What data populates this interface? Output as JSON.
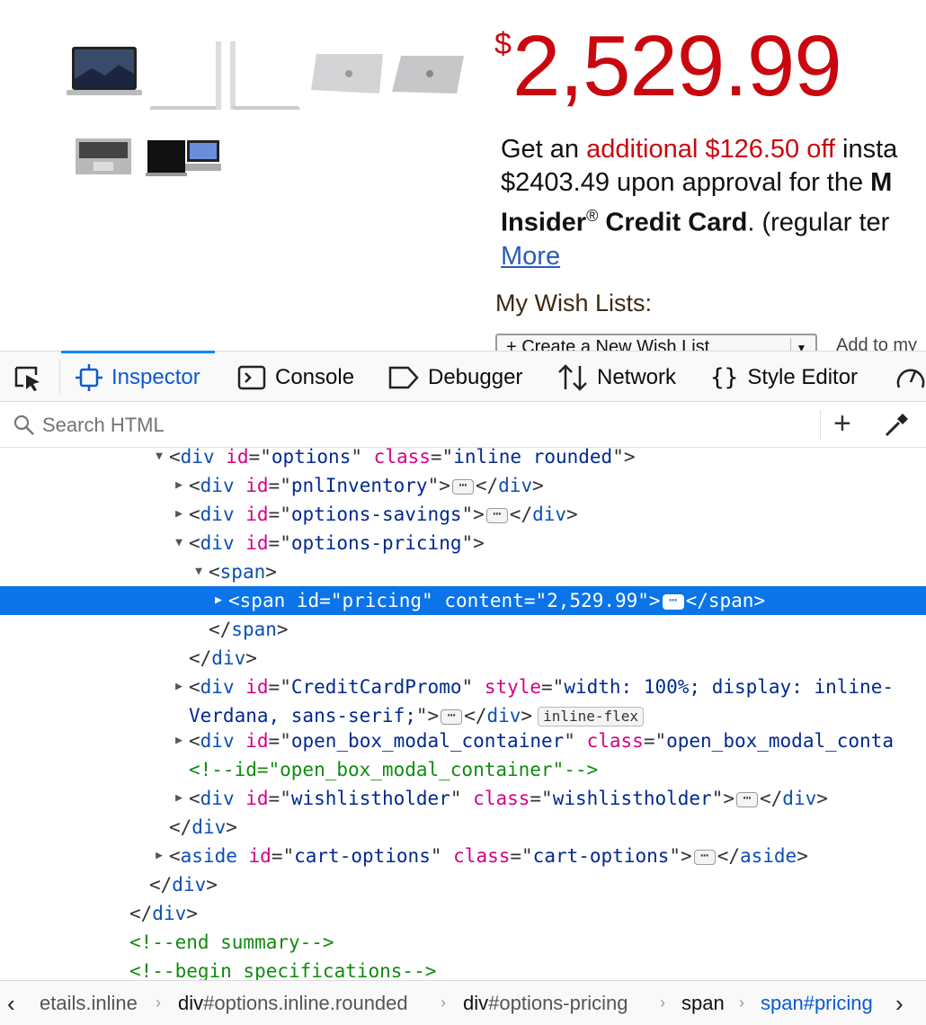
{
  "product": {
    "thumbnails": [
      "macbook-screen-front",
      "macbook-side-open",
      "macbook-lid-closed-angle",
      "macbook-lid-closed-front",
      "macbook-keyboard-top",
      "macbook-screen-black",
      "macbook-screen-colorful"
    ],
    "currency_symbol": "$",
    "price": "2,529.99",
    "promo": {
      "line1_pre": "Get an ",
      "line1_red": "additional $126.50 off",
      "line1_post": " insta",
      "line2_pre": "$2403.49 upon approval for the ",
      "line2_bold": "M",
      "line3_bold_a": "Insider",
      "line3_reg": "®",
      "line3_bold_b": " Credit Card",
      "line3_post": ". (regular ter",
      "more_link": "More"
    },
    "wishlist_label": "My Wish Lists:",
    "wishlist_select": "+ Create a New Wish List",
    "add_to_label": "Add to my"
  },
  "devtools": {
    "tabs": [
      {
        "label": "Inspector",
        "icon": "inspector-icon",
        "active": true
      },
      {
        "label": "Console",
        "icon": "console-icon"
      },
      {
        "label": "Debugger",
        "icon": "debugger-icon"
      },
      {
        "label": "Network",
        "icon": "network-icon"
      },
      {
        "label": "Style Editor",
        "icon": "style-editor-icon"
      }
    ],
    "search_placeholder": "Search HTML",
    "tree": {
      "l0": {
        "tag": "div",
        "attrs": [
          [
            "id",
            "options"
          ],
          [
            "class",
            "inline rounded"
          ]
        ]
      },
      "l1": {
        "tag": "div",
        "id_val": "pnlInventory"
      },
      "l2": {
        "tag": "div",
        "id_val": "options-savings"
      },
      "l3": {
        "tag": "div",
        "id_val": "options-pricing"
      },
      "l4": {
        "tag": "span"
      },
      "l5": {
        "tag": "span",
        "id_val": "pricing",
        "content_val": "2,529.99"
      },
      "l6": {
        "close": "span"
      },
      "l7": {
        "close": "div"
      },
      "l8": {
        "tag": "div",
        "id_val": "CreditCardPromo",
        "style_val_a": "width: 100%; display: inline-",
        "style_val_b": "Verdana, sans-serif;",
        "badge": "inline-flex"
      },
      "l10": {
        "tag": "div",
        "id_val": "open_box_modal_container",
        "class_val": "open_box_modal_conta"
      },
      "l11": {
        "comment": "<!--id=\"open_box_modal_container\"-->"
      },
      "l12": {
        "tag": "div",
        "id_val": "wishlistholder",
        "class_val": "wishlistholder"
      },
      "l13": {
        "close": "div"
      },
      "l14": {
        "tag": "aside",
        "id_val": "cart-options",
        "class_val": "cart-options"
      },
      "l15": {
        "close": "div"
      },
      "l16": {
        "close": "div"
      },
      "l17": {
        "comment": "<!--end summary-->"
      },
      "l18": {
        "comment": "<!--begin specifications-->"
      }
    },
    "breadcrumbs": [
      {
        "text": "etails.inline",
        "id": ""
      },
      {
        "text": "div",
        "id": "#options.inline.rounded"
      },
      {
        "text": "div",
        "id": "#options-pricing"
      },
      {
        "text": "span",
        "id": ""
      },
      {
        "text": "span#pricing",
        "id": ""
      }
    ]
  },
  "colors": {
    "price_red": "#c8080e",
    "active_blue": "#0a84ff",
    "selection_blue": "#0a74e8"
  }
}
